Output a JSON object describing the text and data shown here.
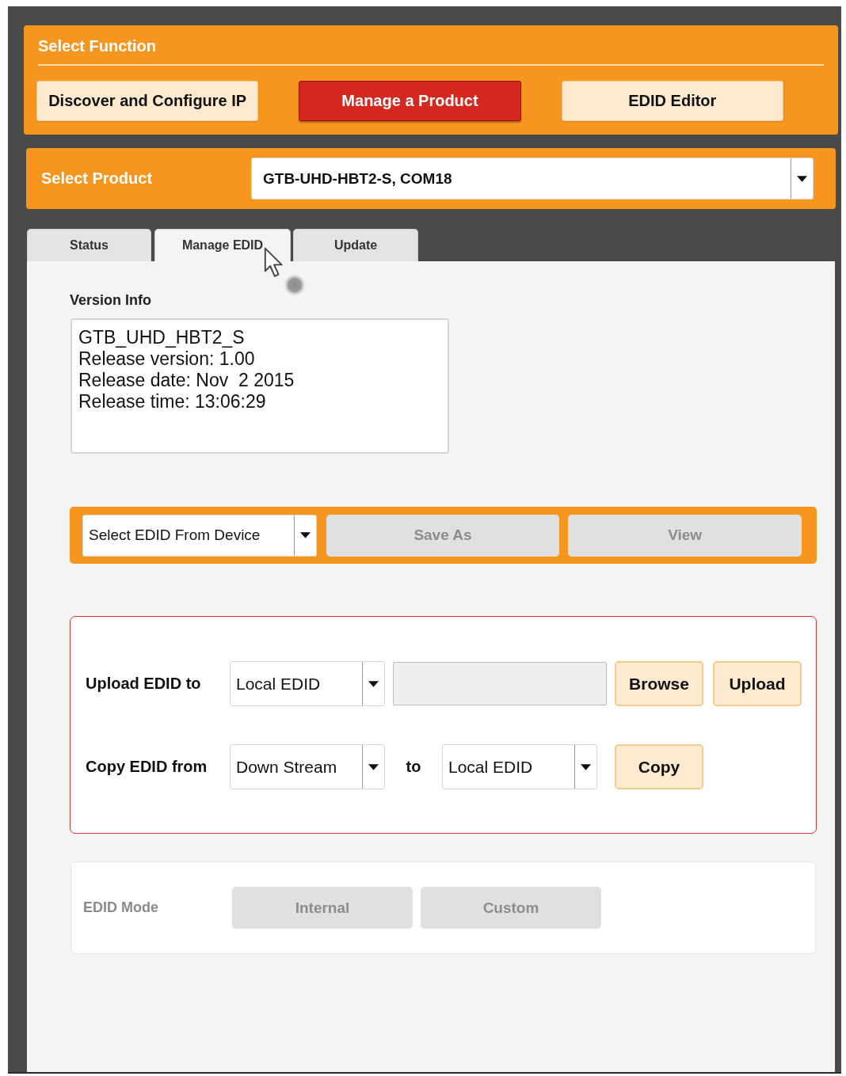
{
  "function_panel": {
    "title": "Select Function",
    "buttons": [
      {
        "label": "Discover and Configure IP",
        "selected": false
      },
      {
        "label": "Manage a Product",
        "selected": true
      },
      {
        "label": "EDID Editor",
        "selected": false
      }
    ]
  },
  "product_panel": {
    "label": "Select Product",
    "value": "GTB-UHD-HBT2-S, COM18"
  },
  "tabs": [
    {
      "label": "Status",
      "selected": false
    },
    {
      "label": "Manage EDID",
      "selected": true
    },
    {
      "label": "Update",
      "selected": false
    }
  ],
  "version_info": {
    "label": "Version Info",
    "lines": [
      "GTB_UHD_HBT2_S",
      "Release version: 1.00",
      "Release date: Nov  2 2015",
      "Release time: 13:06:29"
    ]
  },
  "edid_toolbar": {
    "select": "Select EDID From Device",
    "buttons": [
      {
        "label": "Save As",
        "disabled": true
      },
      {
        "label": "View",
        "disabled": true
      }
    ]
  },
  "transfer_box": {
    "rows": [
      {
        "kind": "upload",
        "label": "Upload EDID to",
        "target": "Local EDID",
        "buttons": [
          "Browse",
          "Upload"
        ]
      },
      {
        "kind": "copy",
        "label": "Copy EDID from",
        "source": "Down Stream",
        "joiner": "to",
        "target": "Local EDID",
        "buttons": [
          "Copy"
        ]
      }
    ]
  },
  "edid_mode": {
    "label": "EDID Mode",
    "disabled": true,
    "buttons": [
      {
        "label": "Internal",
        "disabled": true
      },
      {
        "label": "Custom",
        "disabled": true
      }
    ]
  }
}
